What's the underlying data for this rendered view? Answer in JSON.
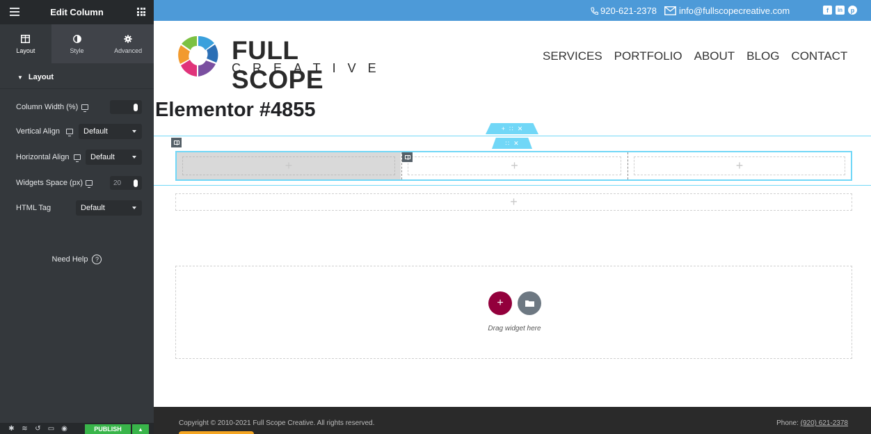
{
  "sidebar": {
    "title": "Edit Column",
    "tabs": [
      {
        "label": "Layout"
      },
      {
        "label": "Style"
      },
      {
        "label": "Advanced"
      }
    ],
    "section": "Layout",
    "controls": {
      "column_width": {
        "label": "Column Width (%)",
        "value": ""
      },
      "vertical_align": {
        "label": "Vertical Align",
        "value": "Default"
      },
      "horizontal_align": {
        "label": "Horizontal Align",
        "value": "Default"
      },
      "widgets_space": {
        "label": "Widgets Space (px)",
        "placeholder": "20"
      },
      "html_tag": {
        "label": "HTML Tag",
        "value": "Default"
      }
    },
    "need_help": "Need Help",
    "publish": "PUBLISH"
  },
  "site": {
    "topbar": {
      "phone": "920-621-2378",
      "email": "info@fullscopecreative.com",
      "social": [
        "f",
        "in",
        "p"
      ]
    },
    "logo": {
      "line1": "FULL SCOPE",
      "line2": "CREATIVE"
    },
    "nav": [
      "SERVICES",
      "PORTFOLIO",
      "ABOUT",
      "BLOG",
      "CONTACT"
    ],
    "page_title": "Elementor #4855",
    "dropzone_text": "Drag widget here",
    "footer": {
      "copyright": "Copyright © 2010-2021 Full Scope Creative. All rights reserved.",
      "phone_label": "Phone:",
      "phone_number": "(920) 621-2378"
    }
  },
  "colors": {
    "sidebar_bg": "#34383c",
    "topbar": "#4d9ad8",
    "editor_accent": "#71d7f7",
    "add_button": "#93003c",
    "publish": "#39b54a"
  }
}
